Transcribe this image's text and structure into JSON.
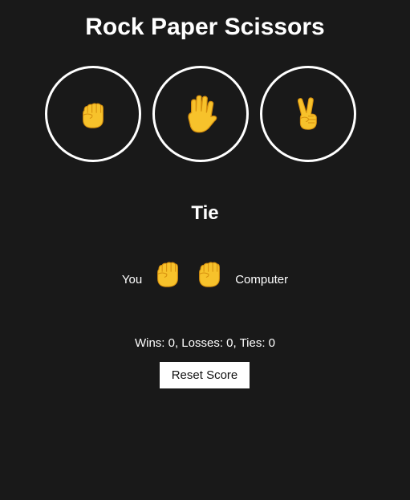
{
  "title": "Rock Paper Scissors",
  "choices": [
    {
      "id": "rock",
      "icon": "fist-icon"
    },
    {
      "id": "paper",
      "icon": "raised-hand-icon"
    },
    {
      "id": "scissors",
      "icon": "victory-hand-icon"
    }
  ],
  "result": {
    "text": "Tie",
    "player_label": "You",
    "player_icon": "fist-icon",
    "computer_label": "Computer",
    "computer_icon": "fist-icon"
  },
  "score": {
    "text": "Wins: 0, Losses: 0, Ties: 0"
  },
  "reset_label": "Reset Score",
  "colors": {
    "background": "#191919",
    "emoji_fill": "#f7c22b",
    "emoji_outline": "#d68f0e",
    "ring": "#ffffff"
  }
}
